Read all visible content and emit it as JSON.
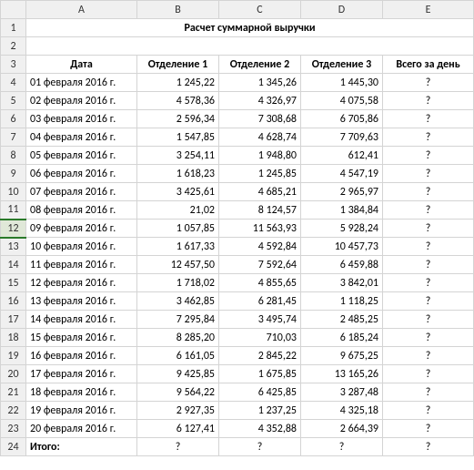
{
  "columns": [
    "A",
    "B",
    "C",
    "D",
    "E"
  ],
  "title": "Расчет суммарной выручки",
  "headers": {
    "date": "Дата",
    "d1": "Отделение 1",
    "d2": "Отделение 2",
    "d3": "Отделение 3",
    "total": "Всего за день"
  },
  "rows": [
    {
      "n": 4,
      "date": "01 февраля 2016 г.",
      "d1": "1 245,22",
      "d2": "1 345,26",
      "d3": "1 445,30",
      "t": "?"
    },
    {
      "n": 5,
      "date": "02 февраля 2016 г.",
      "d1": "4 578,36",
      "d2": "4 326,97",
      "d3": "4 075,58",
      "t": "?"
    },
    {
      "n": 6,
      "date": "03 февраля 2016 г.",
      "d1": "2 596,34",
      "d2": "7 308,68",
      "d3": "6 705,86",
      "t": "?"
    },
    {
      "n": 7,
      "date": "04 февраля 2016 г.",
      "d1": "1 547,85",
      "d2": "4 628,74",
      "d3": "7 709,63",
      "t": "?"
    },
    {
      "n": 8,
      "date": "05 февраля 2016 г.",
      "d1": "3 254,11",
      "d2": "1 948,80",
      "d3": "612,41",
      "t": "?"
    },
    {
      "n": 9,
      "date": "06 февраля 2016 г.",
      "d1": "1 618,23",
      "d2": "1 245,85",
      "d3": "4 547,19",
      "t": "?"
    },
    {
      "n": 10,
      "date": "07 февраля 2016 г.",
      "d1": "3 425,61",
      "d2": "4 685,21",
      "d3": "2 965,97",
      "t": "?"
    },
    {
      "n": 11,
      "date": "08 февраля 2016 г.",
      "d1": "21,02",
      "d2": "8 124,57",
      "d3": "1 384,84",
      "t": "?"
    },
    {
      "n": 12,
      "date": "09 февраля 2016 г.",
      "d1": "1 057,85",
      "d2": "11 563,93",
      "d3": "5 928,24",
      "t": "?",
      "sel": true
    },
    {
      "n": 13,
      "date": "10 февраля 2016 г.",
      "d1": "1 617,33",
      "d2": "4 592,84",
      "d3": "10 457,73",
      "t": "?"
    },
    {
      "n": 14,
      "date": "11 февраля 2016 г.",
      "d1": "12 457,50",
      "d2": "7 592,64",
      "d3": "6 459,88",
      "t": "?"
    },
    {
      "n": 15,
      "date": "12 февраля 2016 г.",
      "d1": "1 718,02",
      "d2": "4 855,65",
      "d3": "3 842,01",
      "t": "?"
    },
    {
      "n": 16,
      "date": "13 февраля 2016 г.",
      "d1": "3 462,85",
      "d2": "6 281,45",
      "d3": "1 118,25",
      "t": "?"
    },
    {
      "n": 17,
      "date": "14 февраля 2016 г.",
      "d1": "7 295,84",
      "d2": "3 495,74",
      "d3": "2 485,25",
      "t": "?"
    },
    {
      "n": 18,
      "date": "15 февраля 2016 г.",
      "d1": "8 285,20",
      "d2": "710,03",
      "d3": "6 185,24",
      "t": "?"
    },
    {
      "n": 19,
      "date": "16 февраля 2016 г.",
      "d1": "6 161,05",
      "d2": "2 845,22",
      "d3": "9 675,25",
      "t": "?"
    },
    {
      "n": 20,
      "date": "17 февраля 2016 г.",
      "d1": "9 425,85",
      "d2": "1 675,85",
      "d3": "13 165,26",
      "t": "?"
    },
    {
      "n": 21,
      "date": "18 февраля 2016 г.",
      "d1": "9 564,22",
      "d2": "6 425,85",
      "d3": "3 287,48",
      "t": "?"
    },
    {
      "n": 22,
      "date": "19 февраля 2016 г.",
      "d1": "2 927,35",
      "d2": "1 237,25",
      "d3": "4 325,18",
      "t": "?"
    },
    {
      "n": 23,
      "date": "20 февраля 2016 г.",
      "d1": "6 127,41",
      "d2": "4 352,88",
      "d3": "2 664,39",
      "t": "?"
    }
  ],
  "footer": {
    "n": 24,
    "label": "Итого:",
    "d1": "?",
    "d2": "?",
    "d3": "?",
    "t": "?"
  },
  "rownums_pre": [
    1,
    2,
    3
  ]
}
